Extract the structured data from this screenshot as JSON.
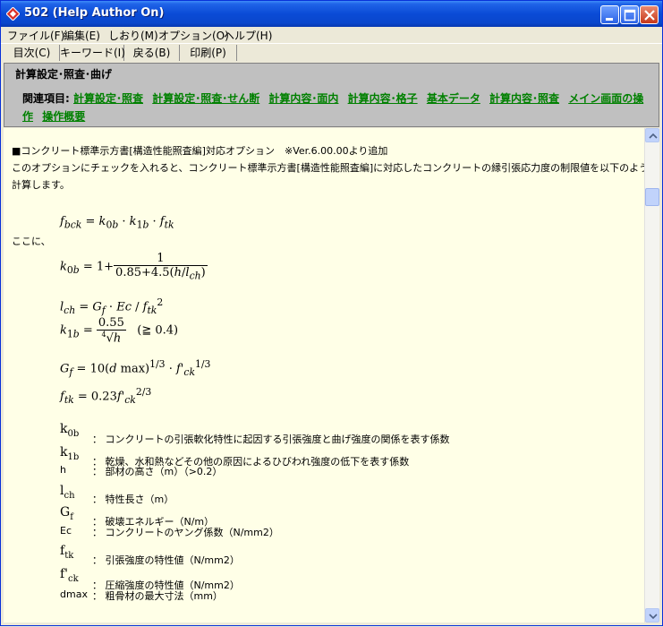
{
  "window": {
    "title": "502  (Help Author On)"
  },
  "menu": [
    "ファイル(F)",
    "編集(E)",
    "しおり(M)",
    "オプション(O)",
    "ヘルプ(H)"
  ],
  "toolbar": [
    "目次(C)",
    "キーワード(I)",
    "戻る(B)",
    "印刷(P)"
  ],
  "header": {
    "title": "計算設定･照査･曲げ",
    "related_label": "関連項目:",
    "links": [
      "計算設定･照査",
      "計算設定･照査･せん断",
      "計算内容･面内",
      "計算内容･格子",
      "基本データ",
      "計算内容･照査",
      "メイン画面の操作",
      "操作概要"
    ]
  },
  "content": {
    "heading": "■コンクリート標準示方書[構造性能照査編]対応オプション　※Ver.6.00.00より追加",
    "para1": "このオプションにチェックを入れると、コンクリート標準示方書[構造性能照査編]に対応したコンクリートの縁引張応力度の制限値を以下のように",
    "para2": "計算します。",
    "koko": "ここに、",
    "definitions": [
      {
        "sym": "k",
        "sub": "0b",
        "desc": "：  コンクリートの引張軟化特性に起因する引張強度と曲げ強度の関係を表す係数"
      },
      {
        "sym": "k",
        "sub": "1b",
        "desc": "：  乾燥、水和熱などその他の原因によるひびわれ強度の低下を表す係数"
      },
      {
        "sym": "h",
        "sub": "",
        "desc": "：  部材の高さ（m）（>0.2）"
      },
      {
        "sym": "l",
        "sub": "ch",
        "desc": "：  特性長さ（m）"
      },
      {
        "sym": "G",
        "sub": "f",
        "desc": "：  破壊エネルギー（N/m）"
      },
      {
        "sym": "Ec",
        "sub": "",
        "desc": "：  コンクリートのヤング係数（N/mm2）"
      },
      {
        "sym": "f",
        "sub": "tk",
        "desc": "：  引張強度の特性値（N/mm2）"
      },
      {
        "sym": "f'",
        "sub": "ck",
        "desc": "：  圧縮強度の特性値（N/mm2）"
      },
      {
        "sym": "dmax",
        "sub": "",
        "desc": "：  粗骨材の最大寸法（mm）"
      }
    ]
  }
}
